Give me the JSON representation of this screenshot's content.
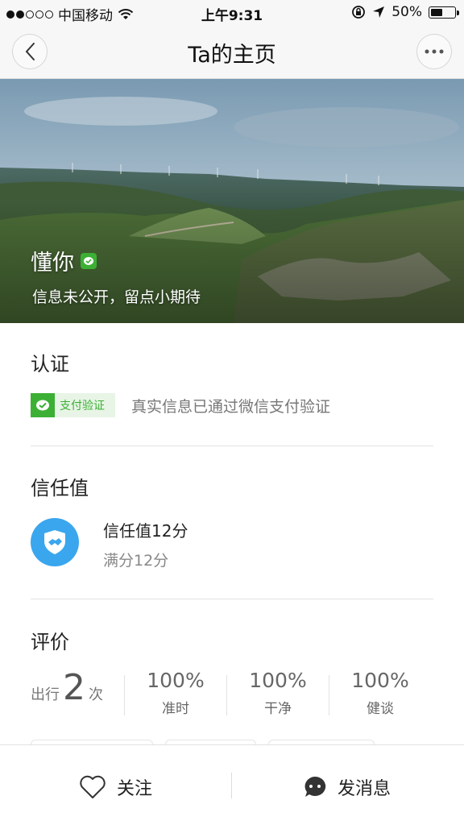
{
  "status_bar": {
    "carrier": "中国移动",
    "time": "上午9:31",
    "battery": "50%",
    "battery_level": 0.5,
    "icons": [
      "signal-dots-icon",
      "wifi-icon",
      "rotation-lock-icon",
      "location-arrow-icon",
      "battery-icon"
    ]
  },
  "nav": {
    "title": "Ta的主页",
    "back_icon": "chevron-left-icon",
    "more_icon": "more-dots-icon"
  },
  "profile": {
    "name": "懂你",
    "subtitle": "信息未公开，留点小期待",
    "badge_icon": "wechat-verified-icon"
  },
  "verification": {
    "title": "认证",
    "tag_label": "支付验证",
    "description": "真实信息已通过微信支付验证",
    "color": "#3cb035"
  },
  "trust": {
    "title": "信任值",
    "score_text": "信任值12分",
    "full_text": "满分12分",
    "icon": "handshake-shield-icon",
    "color": "#3aa6ee"
  },
  "rating": {
    "title": "评价",
    "trips_prefix": "出行",
    "trips_count": "2",
    "trips_suffix": "次",
    "stats": [
      {
        "value": "100%",
        "label": "准时"
      },
      {
        "value": "100%",
        "label": "干净"
      },
      {
        "value": "100%",
        "label": "健谈"
      }
    ]
  },
  "bottom_bar": {
    "follow_label": "关注",
    "follow_icon": "heart-icon",
    "message_label": "发消息",
    "message_icon": "chat-bubble-icon"
  }
}
